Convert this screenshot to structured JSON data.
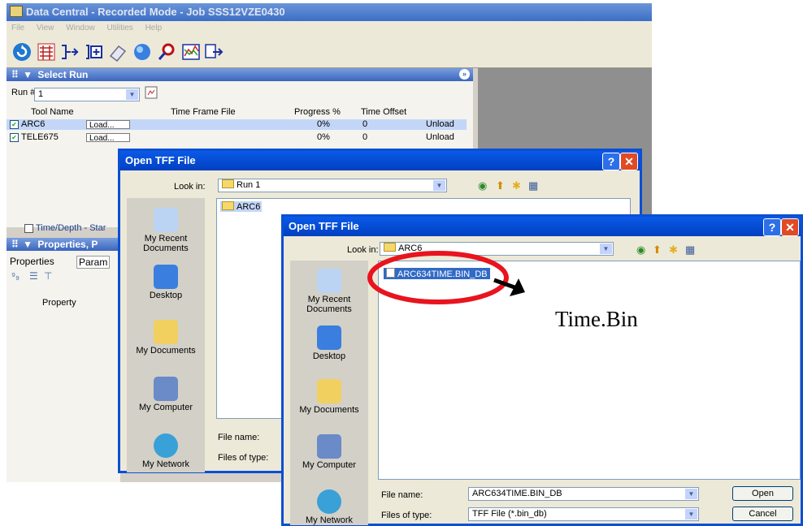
{
  "app": {
    "title": "Data Central - Recorded Mode - Job SSS12VZE0430",
    "menu": [
      "File",
      "View",
      "Window",
      "Utilities",
      "Help"
    ],
    "toolbar_icons": [
      "refresh-icon",
      "tools-icon",
      "merge-icon",
      "add-icon",
      "eraser-icon",
      "globe-icon",
      "magnify-icon",
      "chart-icon",
      "export-icon"
    ]
  },
  "select_run": {
    "title": "Select Run",
    "run_label": "Run #",
    "run_value": "1",
    "columns": [
      "Tool Name",
      "Time Frame File",
      "Progress %",
      "Time Offset"
    ],
    "rows": [
      {
        "tool": "ARC6",
        "load": "Load...",
        "progress": "0%",
        "offset": "0",
        "unload": "Unload"
      },
      {
        "tool": "TELE675",
        "load": "Load...",
        "progress": "0%",
        "offset": "0",
        "unload": "Unload"
      }
    ],
    "time_depth_label": "Time/Depth - Star"
  },
  "properties": {
    "title": "Properties, P",
    "tabs": [
      "Properties",
      "Param"
    ],
    "column": "Property"
  },
  "dialog1": {
    "title": "Open TFF File",
    "look_in_label": "Look in:",
    "look_in_value": "Run 1",
    "files": [
      "ARC6"
    ],
    "places": [
      "My Recent Documents",
      "Desktop",
      "My Documents",
      "My Computer",
      "My Network"
    ],
    "file_name_label": "File name:",
    "files_of_type_label": "Files of type:"
  },
  "dialog2": {
    "title": "Open TFF File",
    "look_in_label": "Look in:",
    "look_in_value": "ARC6",
    "files": [
      "ARC634TIME.BIN_DB"
    ],
    "places": [
      "My Recent Documents",
      "Desktop",
      "My Documents",
      "My Computer",
      "My Network"
    ],
    "file_name_label": "File name:",
    "file_name_value": "ARC634TIME.BIN_DB",
    "files_of_type_label": "Files of type:",
    "files_of_type_value": "TFF File (*.bin_db)",
    "open_button": "Open",
    "cancel_button": "Cancel"
  },
  "annotation": {
    "text": "Time.Bin",
    "circle_color": "#e8141e"
  }
}
